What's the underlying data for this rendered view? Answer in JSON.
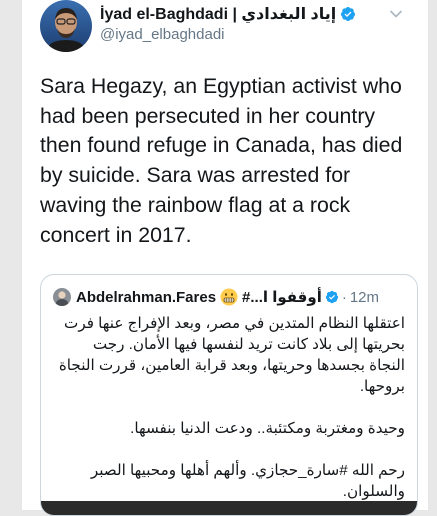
{
  "tweet": {
    "display_name": "İyad el-Baghdadi | إياد البغدادي",
    "handle": "@iyad_elbaghdadi",
    "text": "Sara Hegazy, an Egyptian activist who had been persecuted in her country then found refuge in Canada, has died by suicide. Sara was arrested for waving the rainbow flag at a rock concert in 2017.",
    "icons": {
      "avatar": "avatar",
      "verified": "verified-badge-icon",
      "menu": "chevron-down-icon"
    }
  },
  "quote": {
    "name": "Abdelrahman.Fares",
    "emoji": "😬",
    "name_suffix": "أوقفوا ا...#",
    "separator": "·",
    "time": "12m",
    "paragraphs": [
      "اعتقلها النظام المتدين في مصر، وبعد الإفراج عنها فرت بحريتها إلى بلاد كانت تريد لنفسها فيها الأمان. رجت النجاة بجسدها وحريتها، وبعد قرابة العامين، قررت النجاة بروحها.",
      "وحيدة ومغتربة ومكتئبة.. ودعت الدنيا بنفسها.",
      "رحم الله #سارة_حجازي. وألهم أهلها ومحبيها الصبر والسلوان."
    ]
  },
  "colors": {
    "text": "#14171a",
    "secondary": "#657786",
    "verified": "#1da1f2",
    "border": "#ccd6dd",
    "background": "#e8e8e8"
  }
}
